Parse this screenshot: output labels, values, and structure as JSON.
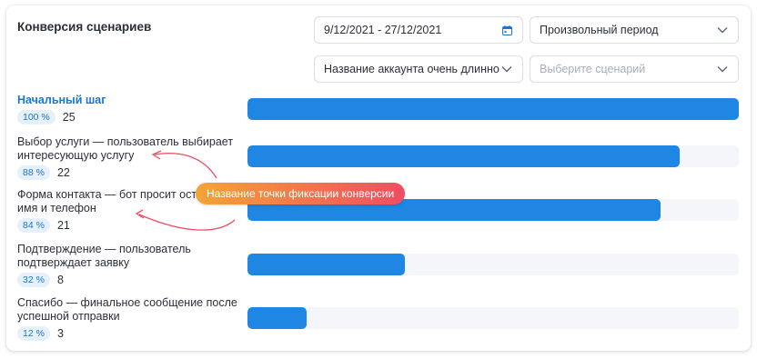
{
  "header": {
    "title": "Конверсия сценариев"
  },
  "filters": {
    "date_range": "9/12/2021 - 27/12/2021",
    "period": "Произвольный период",
    "account": "Название аккаунта очень длинно...",
    "scenario_placeholder": "Выберите сценарий"
  },
  "annotation": "Название точки фиксации конверсии",
  "steps": [
    {
      "name": "Начальный шаг",
      "percent": "100 %",
      "count": "25",
      "fill": 1.0
    },
    {
      "name": "Выбор услуги — пользователь выбирает интересующую услугу",
      "percent": "88 %",
      "count": "22",
      "fill": 0.88
    },
    {
      "name": "Форма контакта — бот просит оставить имя и телефон",
      "percent": "84 %",
      "count": "21",
      "fill": 0.84
    },
    {
      "name": "Подтверждение — пользователь подтверждает заявку",
      "percent": "32 %",
      "count": "8",
      "fill": 0.32
    },
    {
      "name": "Спасибо — финальное сообщение после успешной отправки",
      "percent": "12 %",
      "count": "3",
      "fill": 0.12
    }
  ],
  "colors": {
    "accent": "#1f86e3",
    "track": "#f4f6fa",
    "badge_bg": "#e6f0fb",
    "annot_from": "#f2a436",
    "annot_to": "#ef4d63"
  },
  "icons": {
    "date": "calendar-icon",
    "dropdown": "chevron-down-icon"
  }
}
